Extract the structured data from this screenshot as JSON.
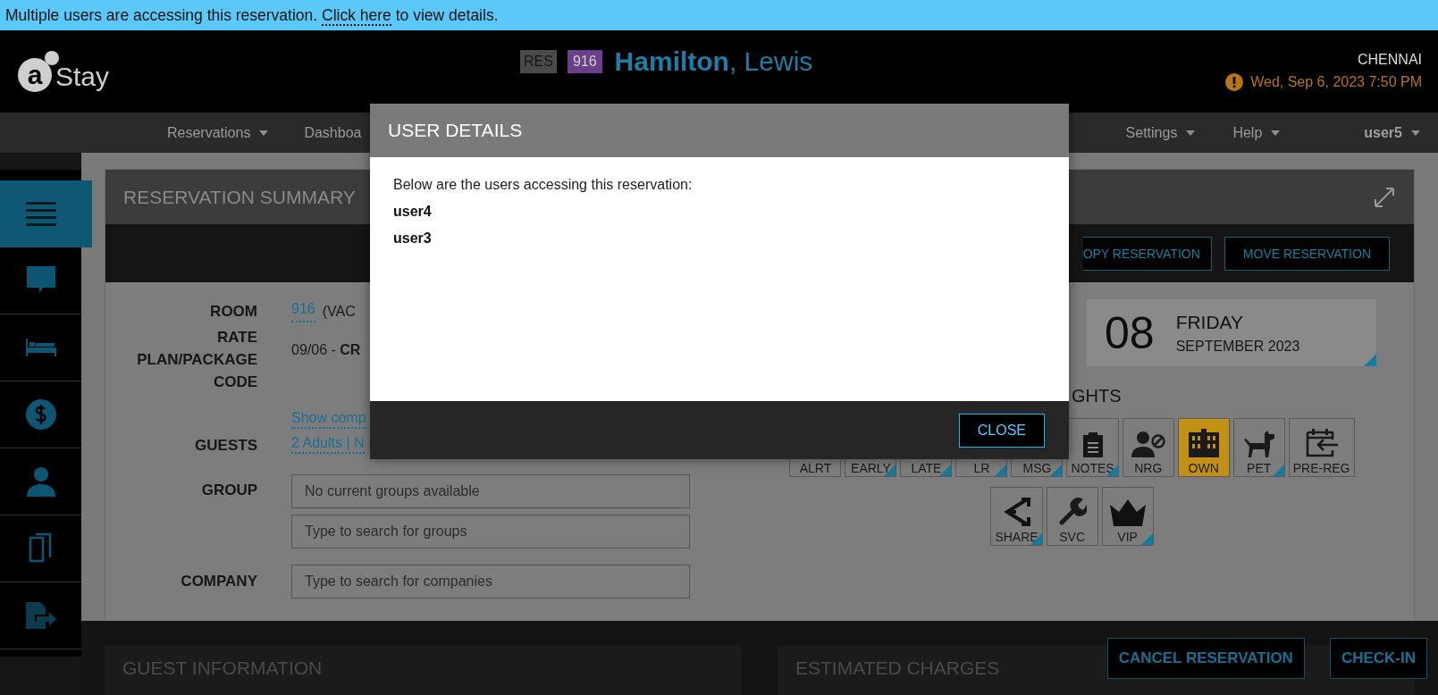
{
  "banner": {
    "text": "Multiple users are accessing this reservation.",
    "link": "Click here",
    "after": "to view details."
  },
  "header": {
    "logo_mark": "a",
    "logo_text": "Stay",
    "res_badge": "RES",
    "room_badge": "916",
    "guest_name": "**Hamilton**, Lewis",
    "location": "CHENNAI",
    "datetime": "Wed, Sep 6, 2023 7:50 PM"
  },
  "nav": {
    "items": [
      {
        "label": "Reservations",
        "caret": true
      },
      {
        "label": "Dashboa",
        "caret": false
      }
    ],
    "right_items": [
      {
        "label": "Settings",
        "caret": true
      },
      {
        "label": "Help",
        "caret": true
      }
    ],
    "user": "user5"
  },
  "sidebar": {
    "items": [
      {
        "kind": "menu",
        "selected": true
      },
      {
        "kind": "chat",
        "selected": false
      },
      {
        "kind": "bed",
        "selected": false
      },
      {
        "kind": "dollar",
        "selected": false
      },
      {
        "kind": "person",
        "selected": false
      },
      {
        "kind": "clipboard",
        "selected": false
      },
      {
        "kind": "export",
        "selected": false
      }
    ]
  },
  "summary": {
    "title": "RESERVATION SUMMARY",
    "actions": [
      "OPY RESERVATION",
      "MOVE RESERVATION"
    ],
    "room": {
      "label": "ROOM",
      "link": "916",
      "text": "(VAC"
    },
    "rate": {
      "label": "RATE PLAN/PACKAGE CODE",
      "value": "09/06 - **CR**"
    },
    "show_link": "Show comp",
    "guests": {
      "label": "GUESTS",
      "link": "2 Adults | N"
    },
    "group": {
      "label": "GROUP",
      "fields": [
        {
          "placeholder": "No current groups available"
        },
        {
          "placeholder": "Type to search for groups"
        }
      ]
    },
    "company": {
      "label": "COMPANY",
      "placeholder": "Type to search for companies"
    },
    "date": {
      "day": "08",
      "weekday": "FRIDAY",
      "month_year": "SEPTEMBER 2023"
    },
    "section": "GHTS",
    "tiles": [
      [
        {
          "kind": "alert",
          "label": "ALRT",
          "active": false,
          "flag": false
        },
        {
          "kind": "early",
          "label": "EARLY",
          "active": false,
          "flag": true
        },
        {
          "kind": "late",
          "label": "LATE",
          "active": false,
          "flag": true
        },
        {
          "kind": "lr",
          "label": "LR",
          "active": false,
          "flag": true
        },
        {
          "kind": "msg",
          "label": "MSG",
          "active": false,
          "flag": true
        },
        {
          "kind": "notes",
          "label": "NOTES",
          "active": false,
          "flag": true
        },
        {
          "kind": "nrg",
          "label": "NRG",
          "active": false,
          "flag": false
        },
        {
          "kind": "own",
          "label": "OWN",
          "active": true,
          "flag": false
        },
        {
          "kind": "pet",
          "label": "PET",
          "active": false,
          "flag": true
        },
        {
          "kind": "prereg",
          "label": "PRE-REG",
          "active": false,
          "flag": false
        }
      ],
      [
        {
          "kind": "share",
          "label": "SHARE",
          "active": false,
          "flag": true
        },
        {
          "kind": "svc",
          "label": "SVC",
          "active": false,
          "flag": false
        },
        {
          "kind": "vip",
          "label": "VIP",
          "active": false,
          "flag": true
        }
      ]
    ]
  },
  "bottom": {
    "panels": [
      "GUEST INFORMATION",
      "ESTIMATED CHARGES"
    ],
    "buttons": [
      "CANCEL RESERVATION",
      "CHECK-IN"
    ]
  },
  "modal": {
    "title": "USER DETAILS",
    "message": "Below are the users accessing this reservation:",
    "users": [
      "user4",
      "user3"
    ],
    "button": "CLOSE"
  }
}
